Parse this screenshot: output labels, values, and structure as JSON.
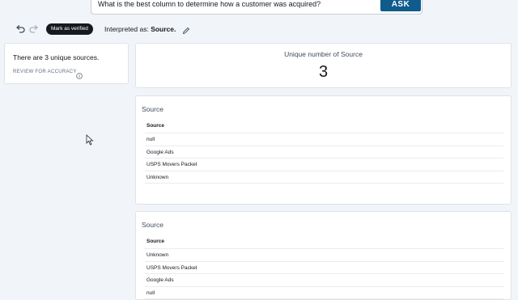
{
  "question_bar": {
    "question": "What is the best column to determine how a customer was acquired?",
    "ask_label": "ASK"
  },
  "toolbar": {
    "undo_icon": "undo-icon",
    "redo_icon": "redo-icon",
    "verified_label": "Mark as verified",
    "interpreted_prefix": "Interpreted as:",
    "interpreted_value": "Source."
  },
  "summary": {
    "text": "There are 3 unique sources.",
    "review_label": "REVIEW FOR ACCURACY"
  },
  "metric": {
    "title": "Unique number of Source",
    "value": "3"
  },
  "tables": [
    {
      "title": "Source",
      "header": "Source",
      "rows": [
        "null",
        "Google Ads",
        "USPS Movers Packet",
        "Unknown"
      ]
    },
    {
      "title": "Source",
      "header": "Source",
      "rows": [
        "Unknown",
        "USPS Movers Packet",
        "Google Ads",
        "null"
      ]
    }
  ],
  "colors": {
    "ask_button": "#0f5c8c",
    "badge": "#16191f",
    "background": "#f1f5f9"
  }
}
